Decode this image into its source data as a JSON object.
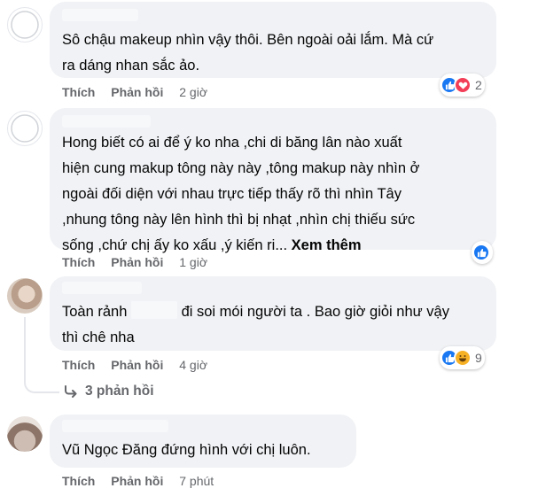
{
  "comments": [
    {
      "text_lines": [
        "Sô chậu makeup nhìn vậy thôi. Bên ngoài oải lắm. Mà cứ",
        "ra dáng nhan sắc ảo."
      ],
      "like_label": "Thích",
      "reply_label": "Phản hồi",
      "time": "2 giờ",
      "reactions": [
        "like-icon",
        "love-icon"
      ],
      "reaction_count": "2"
    },
    {
      "text_lines": [
        "Hong biết có ai để ý ko nha ,chi di băng lân nào xuất",
        "hiện cung makup tông này này ,tông makup này nhìn ở",
        "ngoài đối diện với nhau trực tiếp thấy rõ thì nhìn Tây",
        ",nhung tông này lên hình thì bị nhạt ,nhìn chị thiếu sức"
      ],
      "last_line": "sống ,chứ chị ấy ko xấu ,ý kiến ri...",
      "see_more": "Xem thêm",
      "like_label": "Thích",
      "reply_label": "Phản hồi",
      "time": "1 giờ",
      "reactions": [
        "like-icon"
      ],
      "reaction_count": ""
    },
    {
      "text_before_blur": "Toàn rảnh",
      "text_after_blur": "đi soi mói người ta . Bao giờ giỏi như vậy",
      "text_line2": "thì chê nha",
      "like_label": "Thích",
      "reply_label": "Phản hồi",
      "time": "4 giờ",
      "reactions": [
        "like-icon",
        "haha-icon"
      ],
      "reaction_count": "9",
      "replies_label": "3 phản hồi"
    },
    {
      "text_lines": [
        "Vũ Ngọc Đăng đứng hình với chị luôn."
      ],
      "like_label": "Thích",
      "reply_label": "Phản hồi",
      "time": "7 phút"
    }
  ],
  "colors": {
    "bubble": "#f0f2f5",
    "meta_text": "#65676b",
    "like_blue": "#1877f2",
    "love_red": "#f33e58",
    "haha_yellow": "#f7b125"
  }
}
